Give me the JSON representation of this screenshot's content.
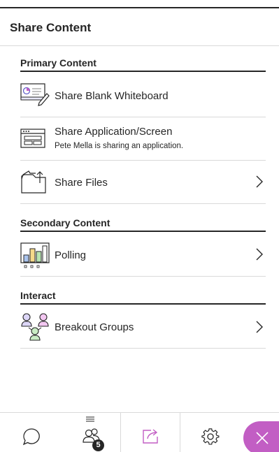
{
  "panel": {
    "title": "Share Content"
  },
  "sections": {
    "primary": "Primary Content",
    "secondary": "Secondary Content",
    "interact": "Interact"
  },
  "items": {
    "whiteboard": {
      "label": "Share Blank Whiteboard",
      "icon": "whiteboard-icon"
    },
    "application": {
      "label": "Share Application/Screen",
      "status": "Pete Mella is sharing an application.",
      "icon": "application-screen-icon"
    },
    "files": {
      "label": "Share Files",
      "icon": "folder-upload-icon"
    },
    "polling": {
      "label": "Polling",
      "icon": "polling-icon"
    },
    "breakout": {
      "label": "Breakout Groups",
      "icon": "breakout-groups-icon"
    }
  },
  "tabbar": {
    "chat": {
      "icon": "chat-icon"
    },
    "attendees": {
      "icon": "attendees-icon",
      "count": "5"
    },
    "share": {
      "icon": "share-content-icon",
      "active": true
    },
    "settings": {
      "icon": "gear-icon"
    },
    "close": {
      "icon": "close-icon"
    }
  },
  "colors": {
    "accent": "#c25ec4",
    "text": "#262626",
    "divider": "#d9d9d9"
  }
}
